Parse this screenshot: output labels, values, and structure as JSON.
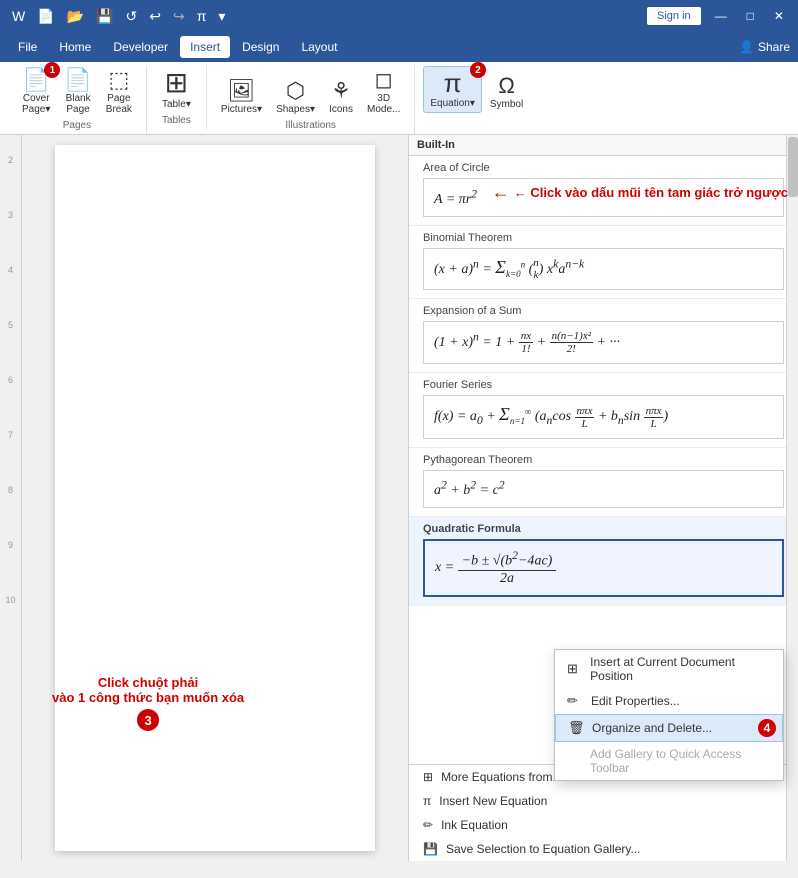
{
  "titlebar": {
    "icons": [
      "📄",
      "💾",
      "🔄",
      "↩",
      "π",
      "▾"
    ],
    "signin_label": "Sign in",
    "win_min": "—",
    "win_max": "□",
    "win_close": "✕"
  },
  "menubar": {
    "items": [
      "File",
      "Home",
      "Developer",
      "Insert",
      "Design",
      "Layout"
    ],
    "active": "Insert",
    "share": "Share"
  },
  "ribbon": {
    "groups": [
      {
        "label": "Pages",
        "buttons": [
          {
            "icon": "📄",
            "label": "Cover\nPage",
            "badge": "1"
          },
          {
            "icon": "📄",
            "label": "Blank\nPage",
            "badge": null
          },
          {
            "icon": "⬚",
            "label": "Page\nBreak",
            "badge": null
          }
        ]
      },
      {
        "label": "Tables",
        "buttons": [
          {
            "icon": "⊞",
            "label": "Table",
            "badge": null
          }
        ]
      },
      {
        "label": "Illustrations",
        "buttons": [
          {
            "icon": "🖼",
            "label": "Pictures",
            "badge": null
          },
          {
            "icon": "⬡",
            "label": "Shapes",
            "badge": null
          },
          {
            "icon": "⊞",
            "label": "Icons",
            "badge": null
          },
          {
            "icon": "◻",
            "label": "3D\nMode...",
            "badge": null
          }
        ]
      },
      {
        "label": "",
        "buttons": [
          {
            "icon": "π",
            "label": "Equation",
            "badge": "2",
            "highlighted": true
          },
          {
            "icon": "Ω",
            "label": "Symbol",
            "badge": null
          }
        ]
      }
    ]
  },
  "callout": {
    "arrow_text": "← Click vào dấu mũi tên tam giác trở ngược"
  },
  "panel": {
    "header": "Built-In",
    "equations": [
      {
        "label": "Area of Circle",
        "formula_html": "A = πr²",
        "selected": false
      },
      {
        "label": "Binomial Theorem",
        "formula_html": "(x + a)ⁿ = Σ(k=0→n) C(n,k) xᵏ aⁿ⁻ᵏ",
        "selected": false
      },
      {
        "label": "Expansion of a Sum",
        "formula_html": "(1 + x)ⁿ = 1 + nx/1! + n(n−1)x²/2! + ···",
        "selected": false
      },
      {
        "label": "Fourier Series",
        "formula_html": "f(x) = a₀ + Σ(n=1→∞)(aₙcos(nπx/L) + bₙsin(nπx/L))",
        "selected": false
      },
      {
        "label": "Pythagorean Theorem",
        "formula_html": "a² + b² = c²",
        "selected": false
      },
      {
        "label": "Quadratic Formula",
        "formula_html": "x = (−b ± √(b²−4ac)) / 2a",
        "selected": true
      }
    ],
    "context_menu": {
      "items": [
        {
          "icon": "⊞",
          "label": "Insert at Current Document Position"
        },
        {
          "icon": "✏",
          "label": "Edit Properties..."
        },
        {
          "icon": "🗑",
          "label": "Organize and Delete...",
          "highlighted": true,
          "badge": "4"
        },
        {
          "icon": "",
          "label": "Add Gallery to Quick Access Toolbar",
          "disabled": true
        }
      ]
    },
    "bottom_items": [
      {
        "icon": "⊞",
        "label": "More Equations from..."
      },
      {
        "icon": "π",
        "label": "Insert New Equation"
      },
      {
        "icon": "✏",
        "label": "Ink Equation"
      },
      {
        "icon": "💾",
        "label": "Save Selection to Equation Gallery..."
      }
    ]
  },
  "click_annotation": {
    "line1": "Click chuột phải",
    "line2": "vào 1 công thức bạn muốn xóa",
    "badge": "3"
  },
  "ruler": {
    "marks": [
      "2",
      "3",
      "4",
      "5",
      "6",
      "7",
      "8",
      "9",
      "10"
    ]
  }
}
